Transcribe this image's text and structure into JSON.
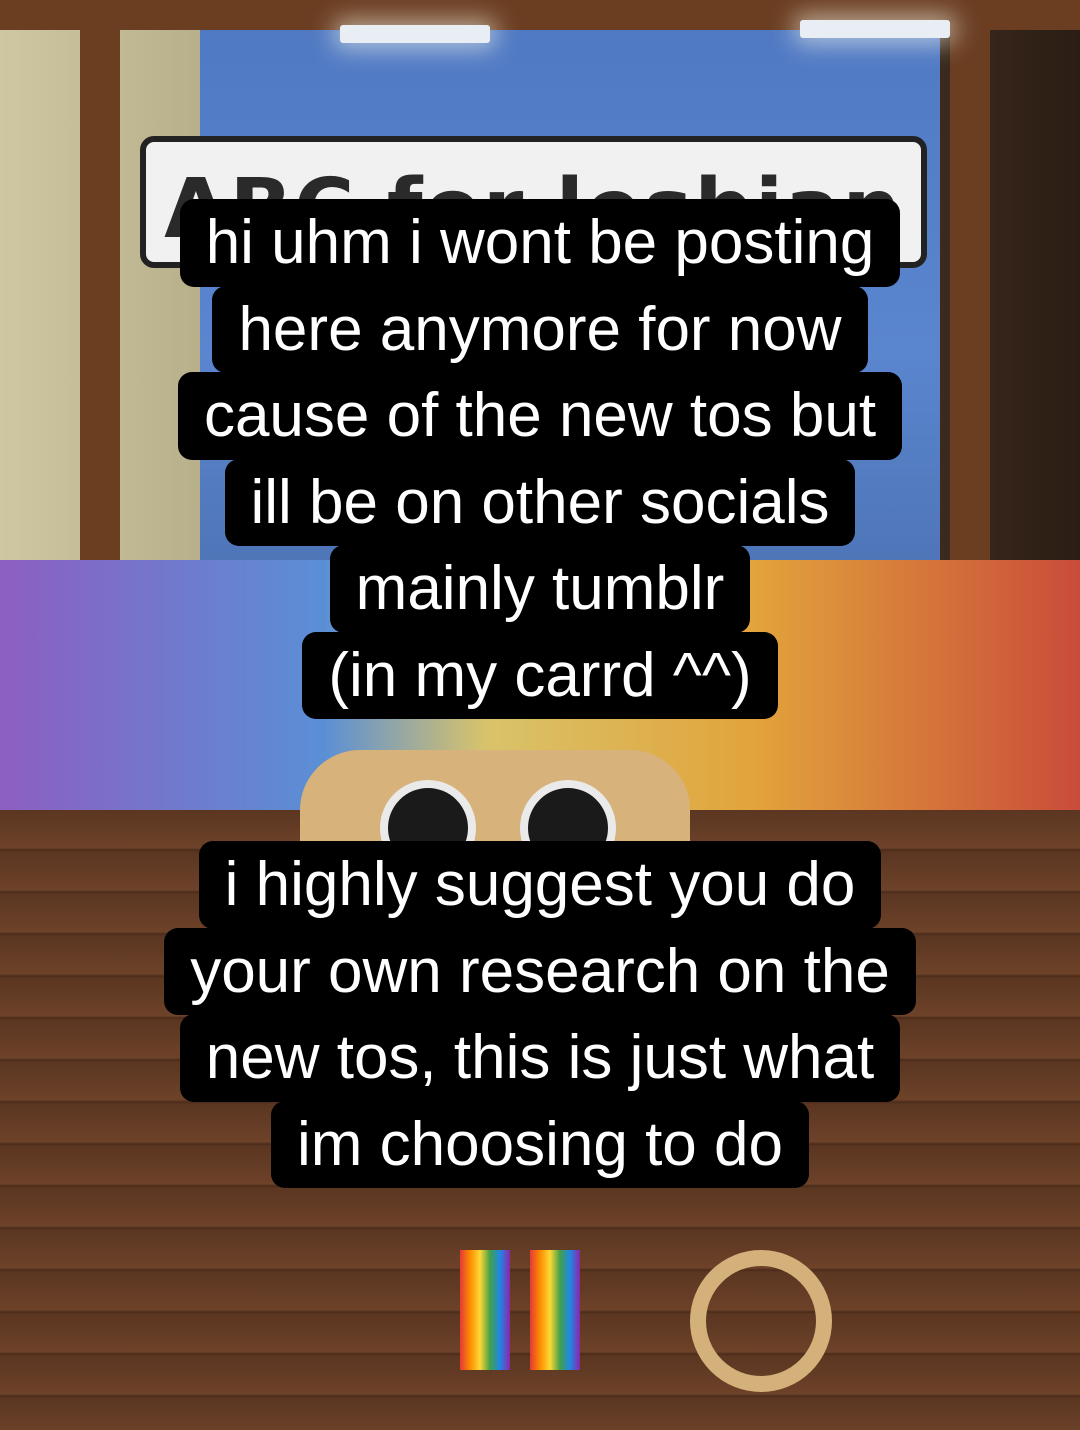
{
  "scene": {
    "sign_text": "ABC for lesbian"
  },
  "caption_top": {
    "lines": [
      "hi uhm i wont be posting",
      "here anymore for now",
      "cause of the new tos but",
      "ill be on other socials",
      "mainly tumblr",
      "(in my carrd ^^)"
    ]
  },
  "caption_bottom": {
    "lines": [
      "i highly suggest you do",
      "your own research on the",
      "new tos, this is just what",
      "im choosing to do"
    ]
  }
}
